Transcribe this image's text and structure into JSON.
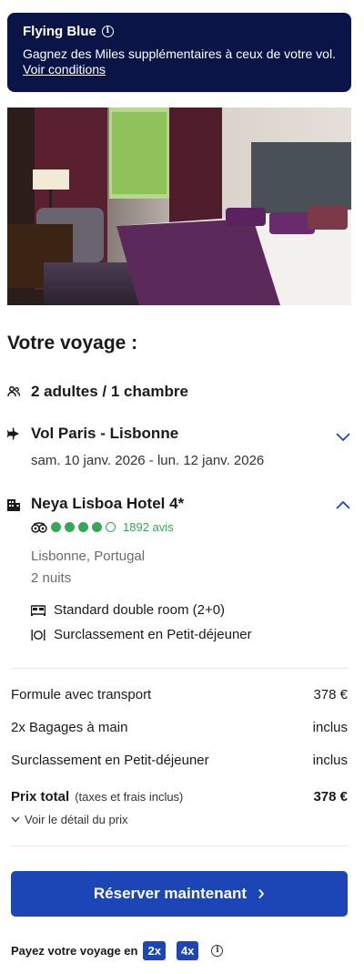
{
  "banner": {
    "title": "Flying Blue",
    "text": "Gagnez des Miles supplémentaires à ceux de votre vol.",
    "link": "Voir conditions"
  },
  "photo": {
    "subject": "hotel-room-photo"
  },
  "trip": {
    "title": "Votre voyage :",
    "travelers": "2 adultes / 1 chambre",
    "flight": {
      "title": "Vol Paris - Lisbonne",
      "dates": "sam. 10 janv. 2026 - lun. 12 janv. 2026"
    },
    "hotel": {
      "name": "Neya Lisboa Hotel 4*",
      "rating_dots": 4,
      "rating_max": 5,
      "reviews": "1892 avis",
      "location": "Lisbonne, Portugal",
      "nights": "2 nuits",
      "room": "Standard double room (2+0)",
      "meal": "Surclassement en Petit-déjeuner"
    }
  },
  "pricing": {
    "rows": [
      {
        "label": "Formule avec transport",
        "value": "378 €"
      },
      {
        "label": "2x Bagages à main",
        "value": "inclus"
      },
      {
        "label": "Surclassement en Petit-déjeuner",
        "value": "inclus"
      }
    ],
    "total_label": "Prix total",
    "total_sub": "(taxes et frais inclus)",
    "total_value": "378 €",
    "detail_link": "Voir le détail du prix"
  },
  "cta": {
    "label": "Réserver maintenant"
  },
  "payment": {
    "label": "Payez votre voyage en",
    "options": [
      "2x",
      "4x"
    ]
  },
  "colors": {
    "banner_bg": "#0b1446",
    "primary": "#1c46b5",
    "rating": "#34a853"
  }
}
